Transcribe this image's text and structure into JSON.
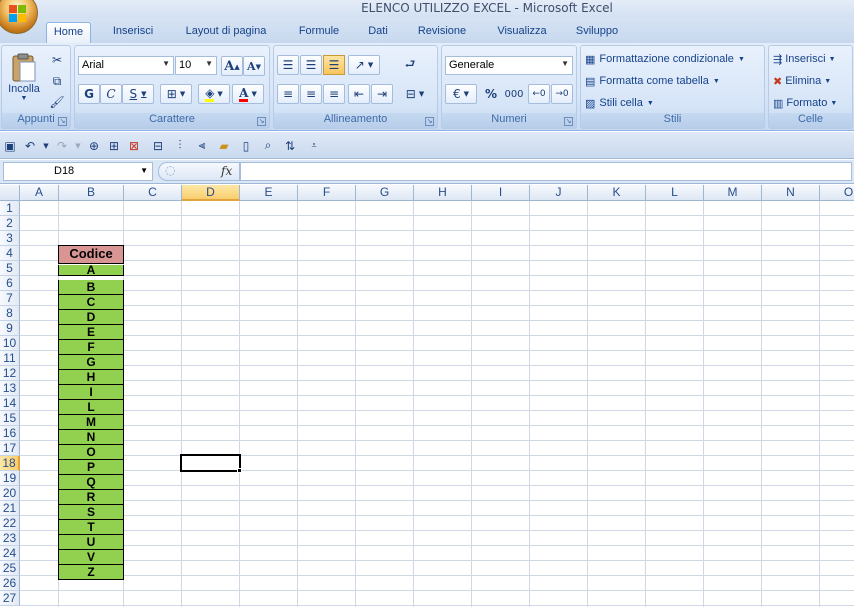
{
  "window": {
    "title": "ELENCO UTILIZZO EXCEL - Microsoft Excel"
  },
  "tabs": [
    {
      "label": "Home",
      "active": true
    },
    {
      "label": "Inserisci"
    },
    {
      "label": "Layout di pagina"
    },
    {
      "label": "Formule"
    },
    {
      "label": "Dati"
    },
    {
      "label": "Revisione"
    },
    {
      "label": "Visualizza"
    },
    {
      "label": "Sviluppo"
    }
  ],
  "ribbon": {
    "clipboard": {
      "label": "Appunti",
      "paste_label": "Incolla"
    },
    "font": {
      "label": "Carattere",
      "font_name": "Arial",
      "font_size": "10",
      "bold": "G",
      "italic": "C",
      "underline": "S"
    },
    "alignment": {
      "label": "Allineamento"
    },
    "number": {
      "label": "Numeri",
      "format": "Generale",
      "percent": "%",
      "thousands": "000"
    },
    "styles": {
      "label": "Stili",
      "conditional": "Formattazione condizionale",
      "table": "Formatta come tabella",
      "cell_styles": "Stili cella"
    },
    "cells": {
      "label": "Celle",
      "insert": "Inserisci",
      "delete": "Elimina",
      "format": "Formato"
    }
  },
  "formula_bar": {
    "name_box": "D18",
    "fx": "fx",
    "formula": ""
  },
  "sheet": {
    "columns": [
      "A",
      "B",
      "C",
      "D",
      "E",
      "F",
      "G",
      "H",
      "I",
      "J",
      "K",
      "L",
      "M",
      "N",
      "O"
    ],
    "rows": [
      "1",
      "2",
      "3",
      "4",
      "5",
      "6",
      "7",
      "8",
      "9",
      "10",
      "11",
      "12",
      "13",
      "14",
      "15",
      "16",
      "17",
      "18",
      "19",
      "20",
      "21",
      "22",
      "23",
      "24",
      "25",
      "26",
      "27"
    ],
    "selected_column": "D",
    "selected_row": "18",
    "header_cell": "Codice",
    "codes": [
      "A",
      "B",
      "C",
      "D",
      "E",
      "F",
      "G",
      "H",
      "I",
      "L",
      "M",
      "N",
      "O",
      "P",
      "Q",
      "R",
      "S",
      "T",
      "U",
      "V",
      "Z"
    ],
    "colors": {
      "header_fill": "#d99594",
      "code_fill": "#92d050"
    }
  }
}
